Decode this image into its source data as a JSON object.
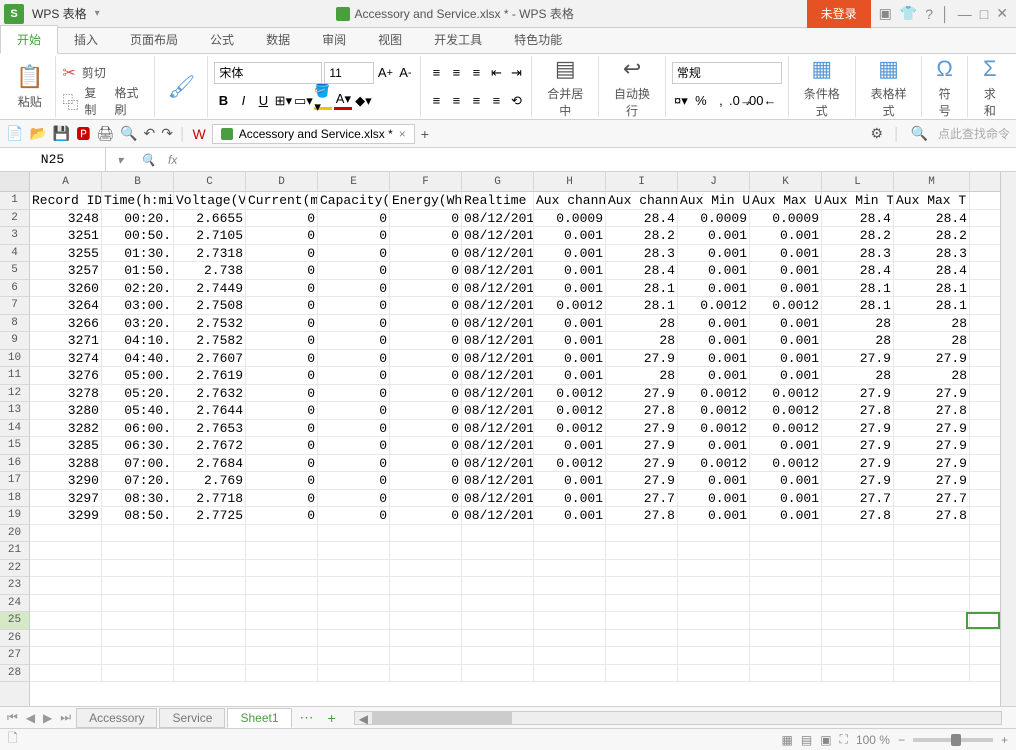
{
  "app": {
    "name": "WPS 表格",
    "title": "Accessory and Service.xlsx * - WPS 表格",
    "login": "未登录"
  },
  "tabs": [
    "开始",
    "插入",
    "页面布局",
    "公式",
    "数据",
    "审阅",
    "视图",
    "开发工具",
    "特色功能"
  ],
  "ribbon": {
    "paste": "粘贴",
    "cut": "剪切",
    "copy": "复制",
    "fmtpaint": "格式刷",
    "font": "宋体",
    "size": "11",
    "merge": "合并居中",
    "wrap": "自动换行",
    "numfmt": "常规",
    "condfmt": "条件格式",
    "tablestyle": "表格样式",
    "symbol": "符号",
    "sum": "求和"
  },
  "quickbar": {
    "doc": "Accessory and Service.xlsx *",
    "search": "点此查找命令"
  },
  "namebox": "N25",
  "columns": [
    "A",
    "B",
    "C",
    "D",
    "E",
    "F",
    "G",
    "H",
    "I",
    "J",
    "K",
    "L",
    "M"
  ],
  "headers": [
    "Record ID",
    "Time(h:mi",
    "Voltage(V",
    "Current(m",
    "Capacity(",
    "Energy(Wh",
    "Realtime",
    "Aux chann",
    "Aux chann",
    "Aux Min U",
    "Aux Max U",
    "Aux Min T",
    "Aux Max T",
    "Au"
  ],
  "rows": [
    [
      "3248",
      "00:20.",
      "2.6655",
      "0",
      "0",
      "0",
      "08/12/201",
      "0.0009",
      "28.4",
      "0.0009",
      "0.0009",
      "28.4",
      "28.4"
    ],
    [
      "3251",
      "00:50.",
      "2.7105",
      "0",
      "0",
      "0",
      "08/12/201",
      "0.001",
      "28.2",
      "0.001",
      "0.001",
      "28.2",
      "28.2"
    ],
    [
      "3255",
      "01:30.",
      "2.7318",
      "0",
      "0",
      "0",
      "08/12/201",
      "0.001",
      "28.3",
      "0.001",
      "0.001",
      "28.3",
      "28.3"
    ],
    [
      "3257",
      "01:50.",
      "2.738",
      "0",
      "0",
      "0",
      "08/12/201",
      "0.001",
      "28.4",
      "0.001",
      "0.001",
      "28.4",
      "28.4"
    ],
    [
      "3260",
      "02:20.",
      "2.7449",
      "0",
      "0",
      "0",
      "08/12/201",
      "0.001",
      "28.1",
      "0.001",
      "0.001",
      "28.1",
      "28.1"
    ],
    [
      "3264",
      "03:00.",
      "2.7508",
      "0",
      "0",
      "0",
      "08/12/201",
      "0.0012",
      "28.1",
      "0.0012",
      "0.0012",
      "28.1",
      "28.1"
    ],
    [
      "3266",
      "03:20.",
      "2.7532",
      "0",
      "0",
      "0",
      "08/12/201",
      "0.001",
      "28",
      "0.001",
      "0.001",
      "28",
      "28"
    ],
    [
      "3271",
      "04:10.",
      "2.7582",
      "0",
      "0",
      "0",
      "08/12/201",
      "0.001",
      "28",
      "0.001",
      "0.001",
      "28",
      "28"
    ],
    [
      "3274",
      "04:40.",
      "2.7607",
      "0",
      "0",
      "0",
      "08/12/201",
      "0.001",
      "27.9",
      "0.001",
      "0.001",
      "27.9",
      "27.9"
    ],
    [
      "3276",
      "05:00.",
      "2.7619",
      "0",
      "0",
      "0",
      "08/12/201",
      "0.001",
      "28",
      "0.001",
      "0.001",
      "28",
      "28"
    ],
    [
      "3278",
      "05:20.",
      "2.7632",
      "0",
      "0",
      "0",
      "08/12/201",
      "0.0012",
      "27.9",
      "0.0012",
      "0.0012",
      "27.9",
      "27.9"
    ],
    [
      "3280",
      "05:40.",
      "2.7644",
      "0",
      "0",
      "0",
      "08/12/201",
      "0.0012",
      "27.8",
      "0.0012",
      "0.0012",
      "27.8",
      "27.8"
    ],
    [
      "3282",
      "06:00.",
      "2.7653",
      "0",
      "0",
      "0",
      "08/12/201",
      "0.0012",
      "27.9",
      "0.0012",
      "0.0012",
      "27.9",
      "27.9"
    ],
    [
      "3285",
      "06:30.",
      "2.7672",
      "0",
      "0",
      "0",
      "08/12/201",
      "0.001",
      "27.9",
      "0.001",
      "0.001",
      "27.9",
      "27.9"
    ],
    [
      "3288",
      "07:00.",
      "2.7684",
      "0",
      "0",
      "0",
      "08/12/201",
      "0.0012",
      "27.9",
      "0.0012",
      "0.0012",
      "27.9",
      "27.9"
    ],
    [
      "3290",
      "07:20.",
      "2.769",
      "0",
      "0",
      "0",
      "08/12/201",
      "0.001",
      "27.9",
      "0.001",
      "0.001",
      "27.9",
      "27.9"
    ],
    [
      "3297",
      "08:30.",
      "2.7718",
      "0",
      "0",
      "0",
      "08/12/201",
      "0.001",
      "27.7",
      "0.001",
      "0.001",
      "27.7",
      "27.7"
    ],
    [
      "3299",
      "08:50.",
      "2.7725",
      "0",
      "0",
      "0",
      "08/12/201",
      "0.001",
      "27.8",
      "0.001",
      "0.001",
      "27.8",
      "27.8"
    ]
  ],
  "sheets": [
    "Accessory",
    "Service",
    "Sheet1"
  ],
  "activeSheet": 2,
  "zoom": "100 %",
  "selRow": 25
}
